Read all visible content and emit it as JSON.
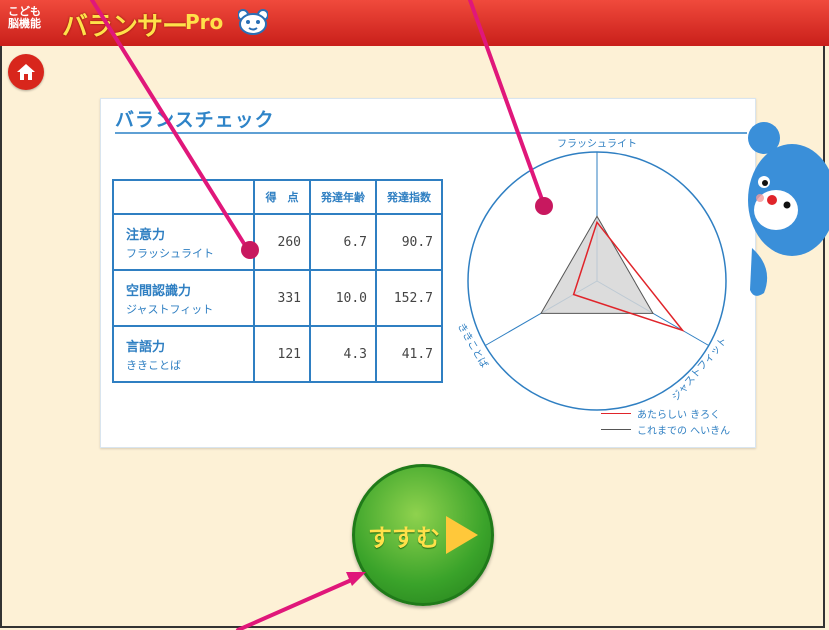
{
  "app": {
    "logo_small": "こども\n脳機能",
    "logo_name": "バランサー",
    "logo_pro": "Pro"
  },
  "panel": {
    "title": "バランスチェック"
  },
  "table": {
    "headers": [
      "得　点",
      "発達年齢",
      "発達指数"
    ],
    "rows": [
      {
        "ability": "注意力",
        "game": "フラッシュライト",
        "score": "260",
        "age": "6.7",
        "index": "90.7"
      },
      {
        "ability": "空間認識力",
        "game": "ジャストフィット",
        "score": "331",
        "age": "10.0",
        "index": "152.7"
      },
      {
        "ability": "言語力",
        "game": "ききことば",
        "score": "121",
        "age": "4.3",
        "index": "41.7"
      }
    ]
  },
  "radar": {
    "axis_labels": [
      "フラッシュライト",
      "ジャストフィット",
      "ききことば"
    ],
    "new_record": [
      90.7,
      152.7,
      41.7
    ],
    "average": [
      100,
      100,
      100
    ],
    "colors": {
      "new": "#e0242a",
      "average": "#555555",
      "axes": "#2f7fc2"
    }
  },
  "legend": {
    "new": "あたらしい きろく",
    "average": "これまでの へいきん"
  },
  "next_button": {
    "label": "すすむ"
  }
}
